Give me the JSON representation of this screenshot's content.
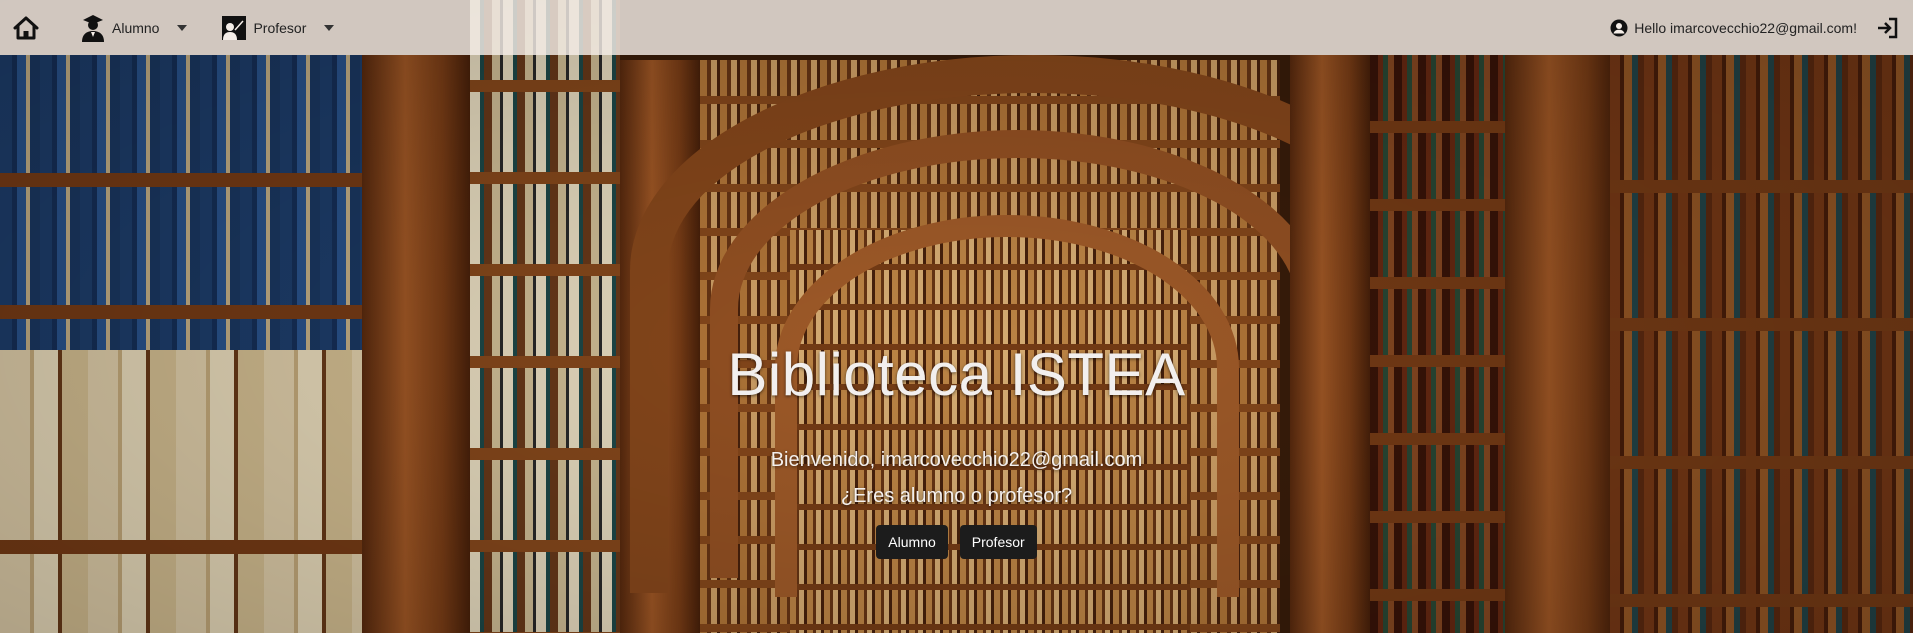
{
  "navbar": {
    "home_icon": "home-icon",
    "menus": [
      {
        "label": "Alumno",
        "icon": "student-icon"
      },
      {
        "label": "Profesor",
        "icon": "teacher-icon"
      }
    ],
    "greeting": "Hello imarcovecchio22@gmail.com!",
    "user_icon": "user-circle-icon",
    "logout_icon": "logout-icon"
  },
  "hero": {
    "title": "Biblioteca ISTEA",
    "welcome": "Bienvenido, imarcovecchio22@gmail.com",
    "question": "¿Eres alumno o profesor?",
    "buttons": {
      "student": "Alumno",
      "teacher": "Profesor"
    }
  },
  "colors": {
    "navbar_bg": "#f5eee8",
    "button_bg": "#1c1c1c",
    "text_light": "#f2efee"
  }
}
